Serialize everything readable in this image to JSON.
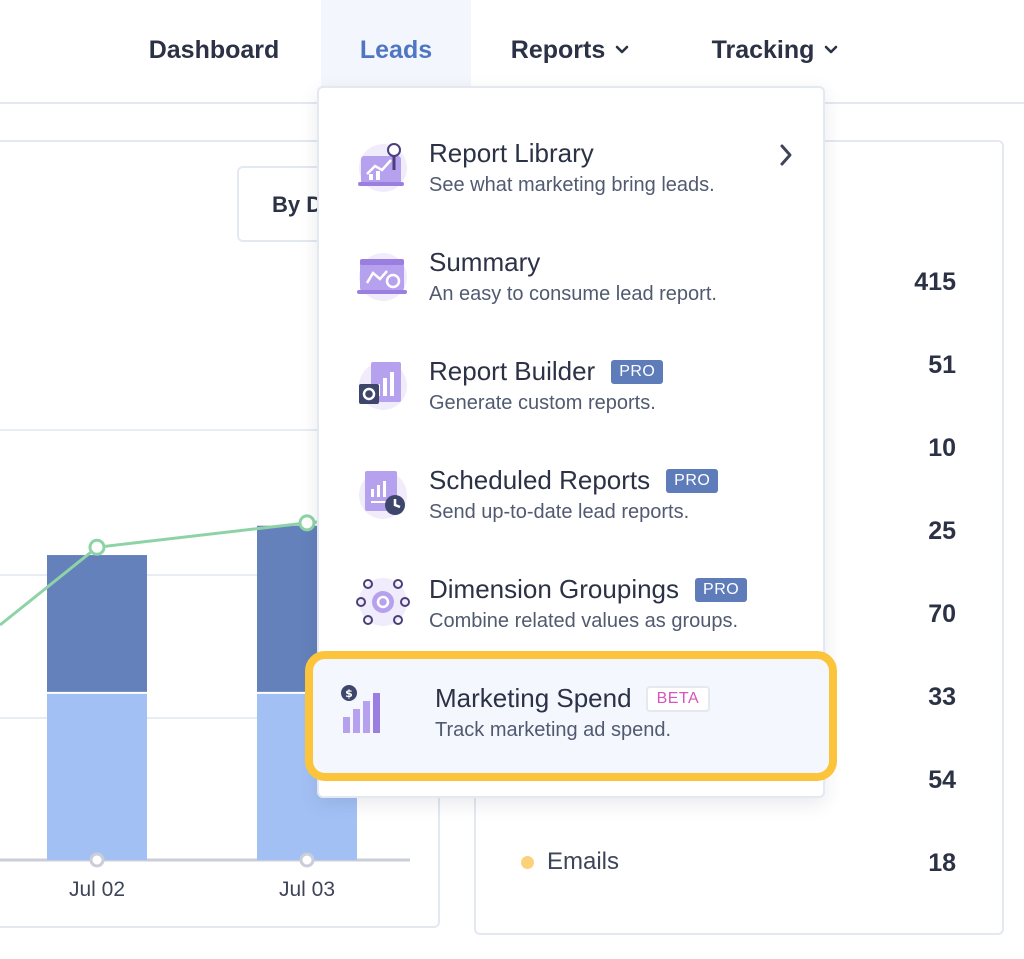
{
  "nav": {
    "items": [
      {
        "label": "Dashboard",
        "active": false,
        "has_chevron": false
      },
      {
        "label": "Leads",
        "active": true,
        "has_chevron": false
      },
      {
        "label": "Reports",
        "active": false,
        "has_chevron": true
      },
      {
        "label": "Tracking",
        "active": false,
        "has_chevron": true
      }
    ]
  },
  "chart": {
    "filter_label": "By D",
    "x_labels": [
      "Jul 02",
      "Jul 03"
    ]
  },
  "chart_data": {
    "type": "bar",
    "categories": [
      "Jul 02",
      "Jul 03"
    ],
    "series": [
      {
        "values": [
          17,
          17
        ],
        "color": "#a3c0f4"
      },
      {
        "values": [
          14,
          17
        ],
        "color": "#6481bb"
      },
      {
        "values": [
          32,
          34.5
        ],
        "color": "#8ed3a6"
      }
    ],
    "ylim": [
      0,
      44
    ],
    "grid": true
  },
  "legend_panel": {
    "values": [
      "415",
      "51",
      "10",
      "25",
      "70",
      "33",
      "54",
      "18"
    ],
    "last_label": "Emails",
    "last_dot_color": "#fbd27a"
  },
  "dropdown": {
    "items": [
      {
        "title": "Report Library",
        "desc": "See what marketing bring leads.",
        "badge": "",
        "icon": "report-library-icon"
      },
      {
        "title": "Summary",
        "desc": "An easy to consume lead report.",
        "badge": "",
        "icon": "summary-icon"
      },
      {
        "title": "Report Builder",
        "desc": "Generate custom reports.",
        "badge": "PRO",
        "icon": "report-builder-icon"
      },
      {
        "title": "Scheduled Reports",
        "desc": "Send up-to-date lead reports.",
        "badge": "PRO",
        "icon": "scheduled-reports-icon"
      },
      {
        "title": "Dimension Groupings",
        "desc": "Combine related values as groups.",
        "badge": "PRO",
        "icon": "dimension-groupings-icon"
      },
      {
        "title": "Marketing Spend",
        "desc": "Track marketing ad spend.",
        "badge": "BETA",
        "icon": "marketing-spend-icon"
      }
    ]
  },
  "colors": {
    "accent": "#4f76c2",
    "highlight": "#fbc43a",
    "pro_badge": "#5f7cba",
    "beta_text": "#d657b9",
    "icon_purple": "#9b7fe0"
  }
}
